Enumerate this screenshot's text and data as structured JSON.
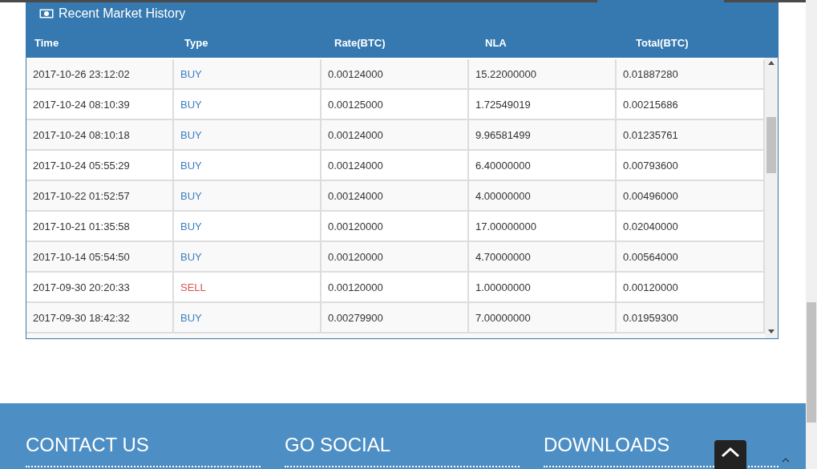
{
  "panel": {
    "title": "Recent Market History"
  },
  "table": {
    "columns": [
      "Time",
      "Type",
      "Rate(BTC)",
      "NLA",
      "Total(BTC)"
    ],
    "rows": [
      {
        "time": "2017-10-26 23:12:02",
        "type": "BUY",
        "kind": "buy",
        "rate": "0.00124000",
        "amount": "15.22000000",
        "total": "0.01887280"
      },
      {
        "time": "2017-10-24 08:10:39",
        "type": "BUY",
        "kind": "buy",
        "rate": "0.00125000",
        "amount": "1.72549019",
        "total": "0.00215686"
      },
      {
        "time": "2017-10-24 08:10:18",
        "type": "BUY",
        "kind": "buy",
        "rate": "0.00124000",
        "amount": "9.96581499",
        "total": "0.01235761"
      },
      {
        "time": "2017-10-24 05:55:29",
        "type": "BUY",
        "kind": "buy",
        "rate": "0.00124000",
        "amount": "6.40000000",
        "total": "0.00793600"
      },
      {
        "time": "2017-10-22 01:52:57",
        "type": "BUY",
        "kind": "buy",
        "rate": "0.00124000",
        "amount": "4.00000000",
        "total": "0.00496000"
      },
      {
        "time": "2017-10-21 01:35:58",
        "type": "BUY",
        "kind": "buy",
        "rate": "0.00120000",
        "amount": "17.00000000",
        "total": "0.02040000"
      },
      {
        "time": "2017-10-14 05:54:50",
        "type": "BUY",
        "kind": "buy",
        "rate": "0.00120000",
        "amount": "4.70000000",
        "total": "0.00564000"
      },
      {
        "time": "2017-09-30 20:20:33",
        "type": "SELL",
        "kind": "sell",
        "rate": "0.00120000",
        "amount": "1.00000000",
        "total": "0.00120000"
      },
      {
        "time": "2017-09-30 18:42:32",
        "type": "BUY",
        "kind": "buy",
        "rate": "0.00279900",
        "amount": "7.00000000",
        "total": "0.01959300"
      }
    ]
  },
  "footer": {
    "headings": [
      "CONTACT US",
      "GO SOCIAL",
      "DOWNLOADS"
    ]
  }
}
